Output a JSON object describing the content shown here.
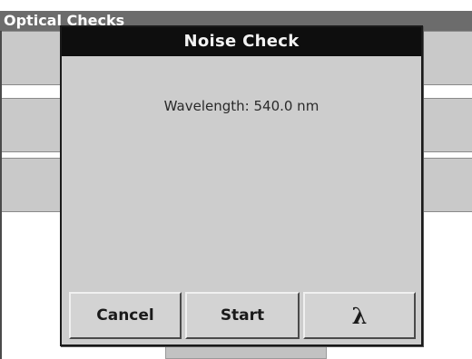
{
  "background_window": {
    "title": "Optical Checks"
  },
  "dialog": {
    "title": "Noise Check",
    "wavelength_text": "Wavelength: 540.0 nm",
    "buttons": {
      "cancel_label": "Cancel",
      "start_label": "Start",
      "lambda_label": "λ"
    }
  },
  "colors": {
    "dialog_title_bg": "#0e0e0e",
    "dialog_bg": "#cdcdcd",
    "bg_title_bg": "#6c6c6c",
    "bg_row": "#c9c9c9"
  }
}
